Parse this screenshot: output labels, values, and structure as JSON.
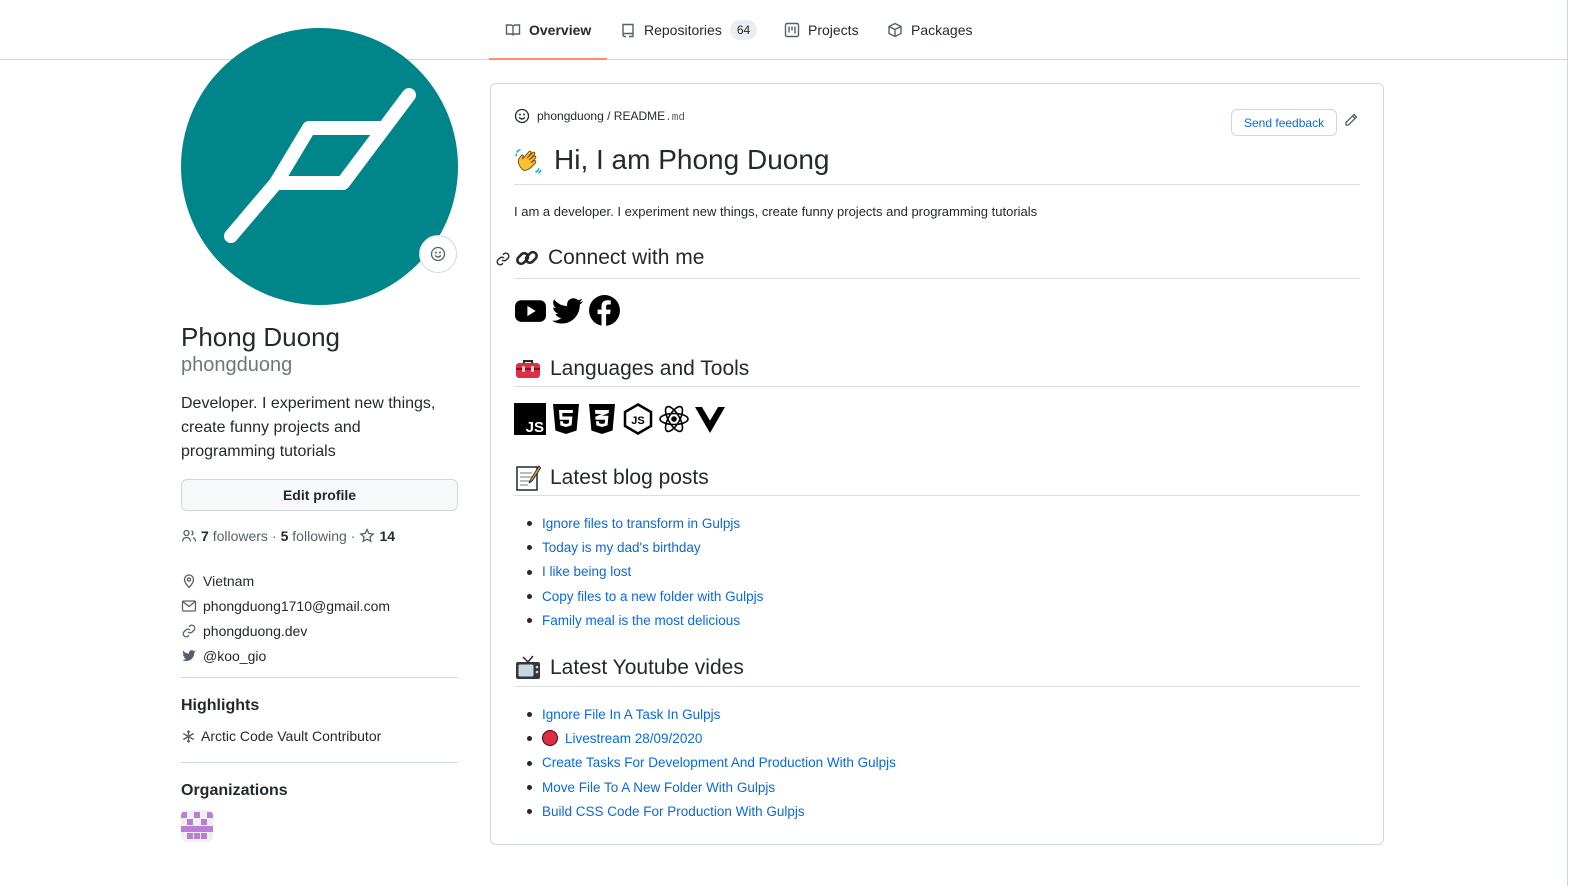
{
  "nav": {
    "tabs": [
      {
        "label": "Overview",
        "icon": "book-icon",
        "active": true
      },
      {
        "label": "Repositories",
        "icon": "repo-icon",
        "count": "64"
      },
      {
        "label": "Projects",
        "icon": "project-icon"
      },
      {
        "label": "Packages",
        "icon": "package-icon"
      }
    ]
  },
  "profile": {
    "fullname": "Phong Duong",
    "login": "phongduong",
    "bio": "Developer. I experiment new things, create funny projects and programming tutorials",
    "edit_label": "Edit profile",
    "followers_count": "7",
    "followers_label": "followers",
    "sep": "·",
    "following_count": "5",
    "following_label": "following",
    "stars_count": "14",
    "location": "Vietnam",
    "email": "phongduong1710@gmail.com",
    "website": "phongduong.dev",
    "twitter": "@koo_gio",
    "avatar_color": "#00868a"
  },
  "highlights": {
    "title": "Highlights",
    "item": "Arctic Code Vault Contributor"
  },
  "organizations": {
    "title": "Organizations"
  },
  "readme": {
    "owner": "phongduong",
    "slash": "/",
    "file": "README",
    "ext": ".md",
    "feedback_label": "Send feedback",
    "heading": "Hi, I am Phong Duong",
    "intro": "I am a developer. I experiment new things, create funny projects and programming tutorials",
    "connect_title": "Connect with me",
    "tools_title": "Languages and Tools",
    "blog_title": "Latest blog posts",
    "blog_posts": [
      "Ignore files to transform in Gulpjs",
      "Today is my dad's birthday",
      "I like being lost",
      "Copy files to a new folder with Gulpjs",
      "Family meal is the most delicious"
    ],
    "youtube_title": "Latest Youtube vides",
    "videos": [
      "Ignore File In A Task In Gulpjs",
      "Livestream 28/09/2020",
      "Create Tasks For Development And Production With Gulpjs",
      "Move File To A New Folder With Gulpjs",
      "Build CSS Code For Production With Gulpjs"
    ]
  },
  "colors": {
    "accent_underline": "#fd8c73",
    "link": "#0969da"
  }
}
